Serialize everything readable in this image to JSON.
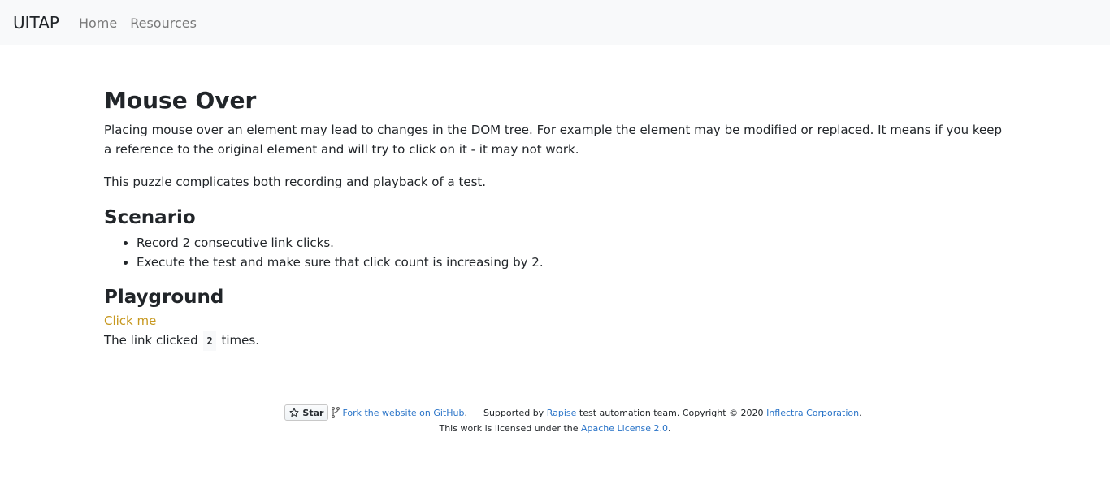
{
  "nav": {
    "brand": "UITAP",
    "links": [
      "Home",
      "Resources"
    ]
  },
  "main": {
    "title": "Mouse Over",
    "description": "Placing mouse over an element may lead to changes in the DOM tree. For example the element may be modified or replaced. It means if you keep a reference to the original element and will try to click on it - it may not work.",
    "description2": "This puzzle complicates both recording and playback of a test.",
    "scenario_title": "Scenario",
    "scenario_items": [
      "Record 2 consecutive link clicks.",
      "Execute the test and make sure that click count is increasing by 2."
    ],
    "playground_title": "Playground",
    "click_link": "Click me",
    "counter_prefix": "The link clicked",
    "counter_value": "2",
    "counter_suffix": "times."
  },
  "footer": {
    "star_label": "Star",
    "fork_link": "Fork the website on GitHub",
    "fork_suffix": ".",
    "supported_prefix": "Supported by",
    "rapise_link": "Rapise",
    "supported_middle": "test automation team. Copyright © 2020",
    "inflectra_link": "Inflectra Corporation",
    "supported_suffix": ".",
    "license_prefix": "This work is licensed under the",
    "license_link": "Apache License 2.0",
    "license_suffix": "."
  },
  "colors": {
    "link_accent": "#c7981f",
    "footer_link": "#2a74c8",
    "navbar_bg": "#f8f9fa"
  }
}
